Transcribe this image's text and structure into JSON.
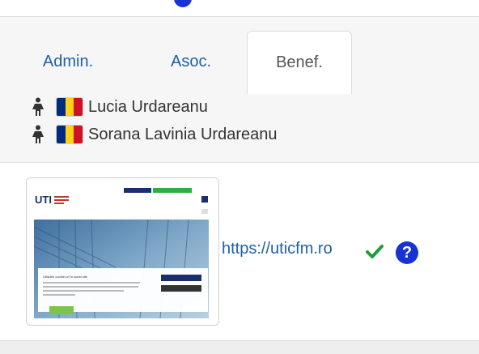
{
  "colors": {
    "link": "#1f5fa8",
    "accent_blue": "#1733d6",
    "check_green": "#1e9e3a",
    "flag_blue": "#002b7f",
    "flag_yellow": "#fcd116",
    "flag_red": "#ce1126"
  },
  "tabs": [
    {
      "label": "Admin.",
      "active": false
    },
    {
      "label": "Asoc.",
      "active": false
    },
    {
      "label": "Benef.",
      "active": true
    }
  ],
  "beneficiaries": [
    {
      "name": "Lucia Urdareanu",
      "icon": "person-icon",
      "flag": "romania-flag-icon"
    },
    {
      "name": "Sorana Lavinia Urdareanu",
      "icon": "person-icon",
      "flag": "romania-flag-icon"
    }
  ],
  "website": {
    "url": "https://uticfm.ro",
    "verified_icon": "check-icon",
    "help_icon": "question-circle-icon",
    "help_glyph": "?",
    "thumbnail": {
      "logo_text": "UTI",
      "logo_subtitle": "CENTRUL DE FORMARE",
      "cookie_title": "Utilizăm cookie-uri în acest site"
    }
  }
}
